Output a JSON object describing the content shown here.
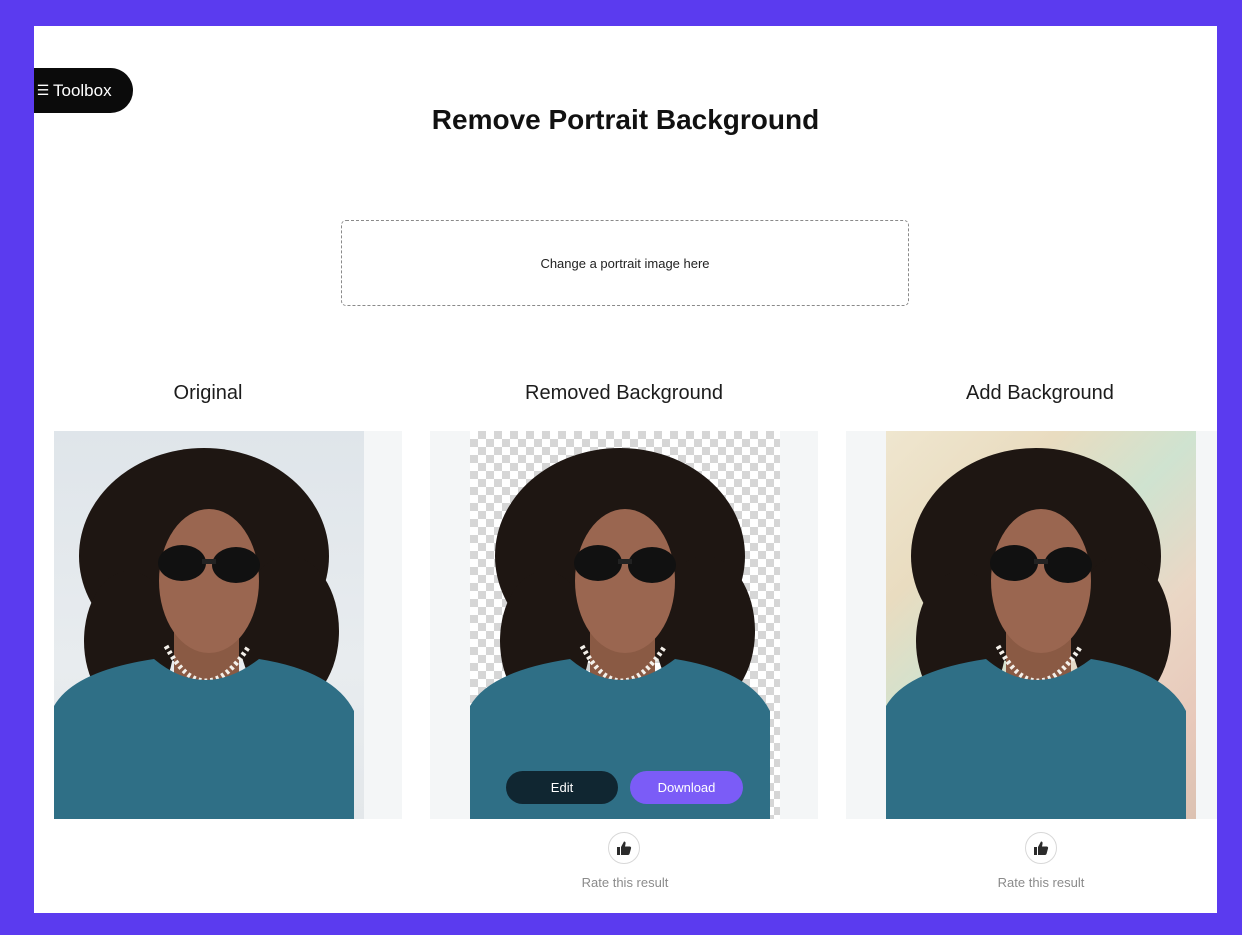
{
  "toolbox": {
    "label": "Toolbox",
    "icon": "menu-icon"
  },
  "header": {
    "title": "Remove Portrait Background"
  },
  "upload": {
    "prompt": "Change a portrait image here"
  },
  "columns": {
    "original": {
      "title": "Original"
    },
    "removed": {
      "title": "Removed Background",
      "edit_label": "Edit",
      "download_label": "Download",
      "rate_label": "Rate this result",
      "rate_icon": "thumbs-up-icon"
    },
    "added": {
      "title": "Add Background",
      "rate_label": "Rate this result",
      "rate_icon": "thumbs-up-icon"
    }
  },
  "colors": {
    "frame_border": "#5b3bef",
    "accent": "#7b5cf7",
    "shirt": "#2f6f86"
  }
}
